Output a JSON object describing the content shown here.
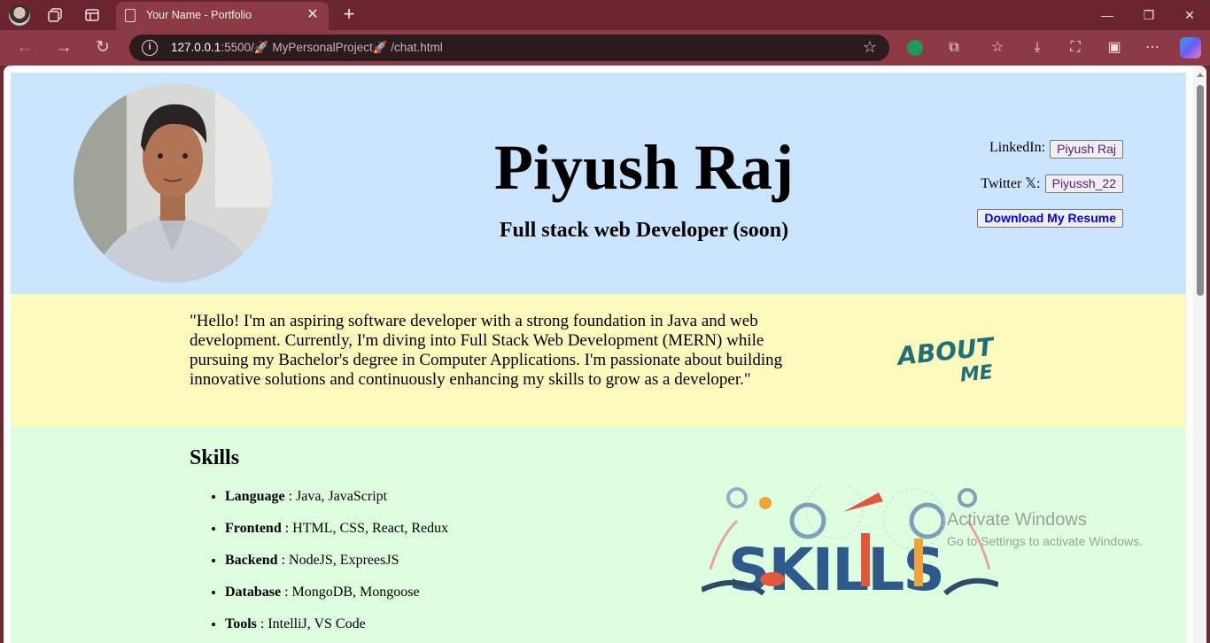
{
  "browser": {
    "tab_title": "Your Name - Portfolio",
    "url_host": "127.0.0.1",
    "url_rest": ":5500/🚀 MyPersonalProject🚀 /chat.html"
  },
  "header": {
    "name": "Piyush Raj",
    "subtitle": "Full stack web Developer (soon)",
    "linkedin_label": "LinkedIn:",
    "linkedin_button": "Piyush Raj",
    "twitter_label": "Twitter 𝕏:",
    "twitter_button": "Piyussh_22",
    "resume_button": "Download My Resume"
  },
  "about": {
    "text": "\"Hello! I'm an aspiring software developer with a strong foundation in Java and web development. Currently, I'm diving into Full Stack Web Development (MERN) while pursuing my Bachelor's degree in Computer Applications. I'm passionate about building innovative solutions and continuously enhancing my skills to grow as a developer.\"",
    "image_text_1": "ABOUT",
    "image_text_2": "ME"
  },
  "skills": {
    "title": "Skills",
    "items": [
      {
        "label": "Language",
        "value": " : Java, JavaScript"
      },
      {
        "label": "Frontend",
        "value": " : HTML, CSS, React, Redux"
      },
      {
        "label": "Backend",
        "value": " : NodeJS, ExpreesJS"
      },
      {
        "label": "Database",
        "value": " : MongoDB, Mongoose"
      },
      {
        "label": "Tools",
        "value": " : IntelliJ, VS Code"
      }
    ],
    "image_text": "SKILLS"
  },
  "watermark": {
    "line1": "Activate Windows",
    "line2": "Go to Settings to activate Windows."
  },
  "colors": {
    "header_bg": "#cce5ff",
    "about_bg": "#fbf9bb",
    "skills_bg": "#ddffdf",
    "browser_frame": "#8c3a45"
  }
}
